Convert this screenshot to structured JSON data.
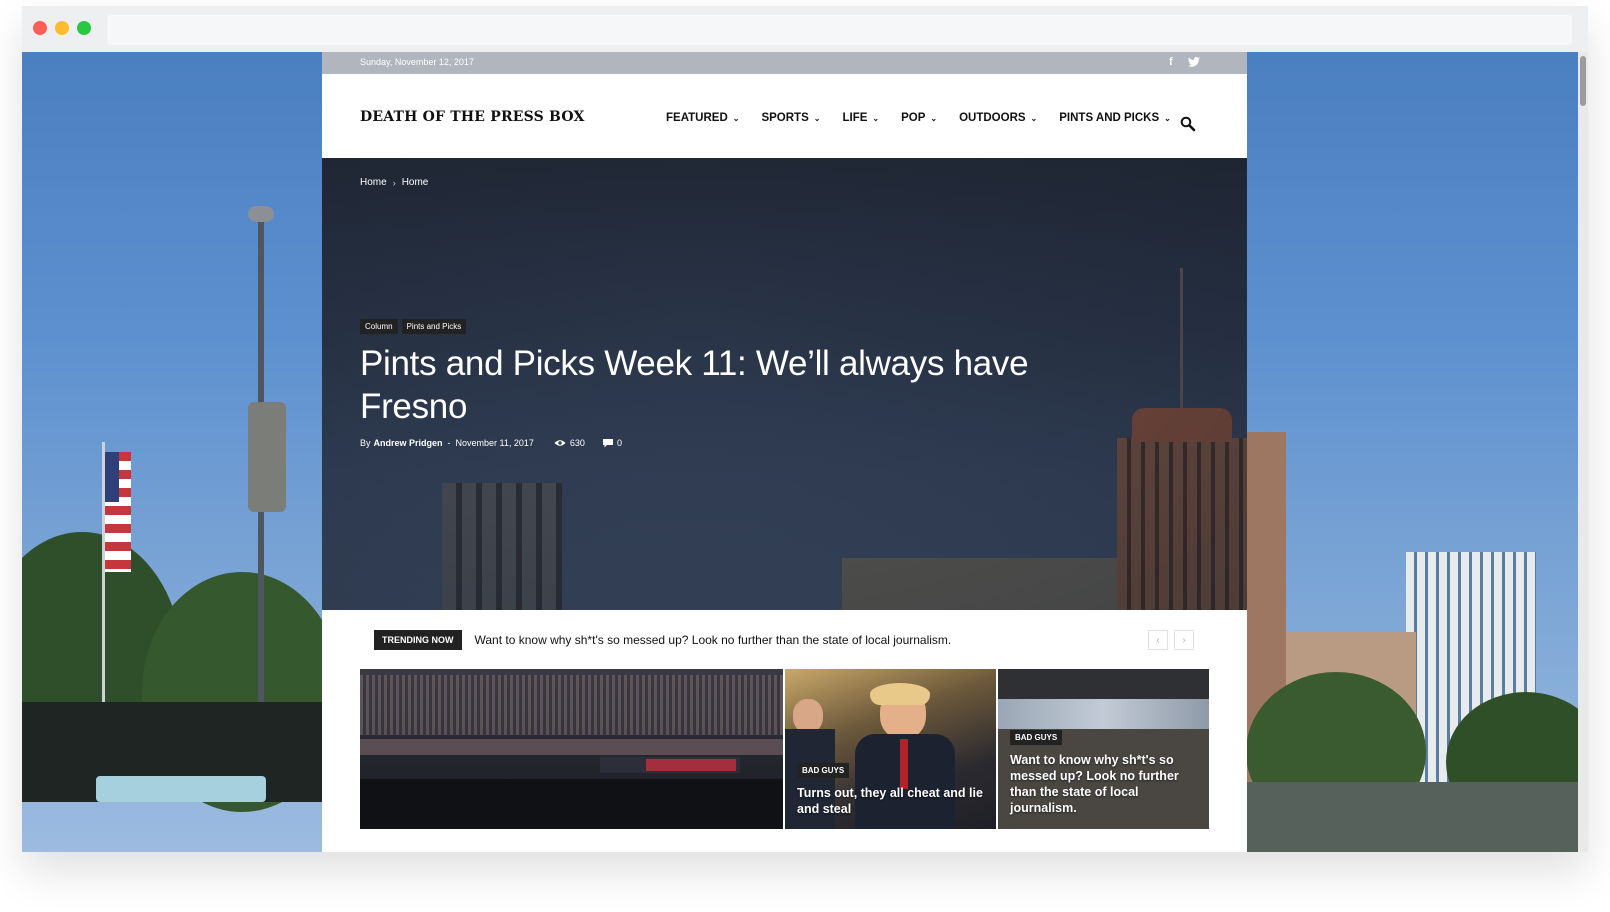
{
  "topbar": {
    "date": "Sunday, November 12, 2017",
    "social_icons": [
      "facebook-icon",
      "twitter-icon"
    ]
  },
  "header": {
    "logo": "DEATH OF THE PRESS BOX",
    "nav": [
      {
        "label": "FEATURED"
      },
      {
        "label": "SPORTS"
      },
      {
        "label": "LIFE"
      },
      {
        "label": "POP"
      },
      {
        "label": "OUTDOORS"
      },
      {
        "label": "PINTS AND PICKS"
      }
    ],
    "search_icon": "search-icon"
  },
  "hero": {
    "breadcrumb": [
      "Home",
      "Home"
    ],
    "categories": [
      "Column",
      "Pints and Picks"
    ],
    "title": "Pints and Picks Week 11: We’ll always have Fresno",
    "by": "By",
    "author": "Andrew Pridgen",
    "dash": "-",
    "date": "November 11, 2017",
    "views": "630",
    "comments": "0"
  },
  "trending": {
    "label": "TRENDING NOW",
    "text": "Want to know why sh*t's so messed up? Look no further than the state of local journalism.",
    "prev": "‹",
    "next": "›"
  },
  "tiles": [
    {
      "category": "",
      "title": ""
    },
    {
      "category": "BAD GUYS",
      "title": "Turns out, they all cheat and lie and steal"
    },
    {
      "category": "BAD GUYS",
      "title": "Want to know why sh*t's so messed up? Look no further than the state of local journalism."
    }
  ],
  "colors": {
    "topbar": "#b1b5be",
    "hero_bg": "#2a3549",
    "tag_bg": "#222222",
    "sky": "#5d90cf"
  }
}
